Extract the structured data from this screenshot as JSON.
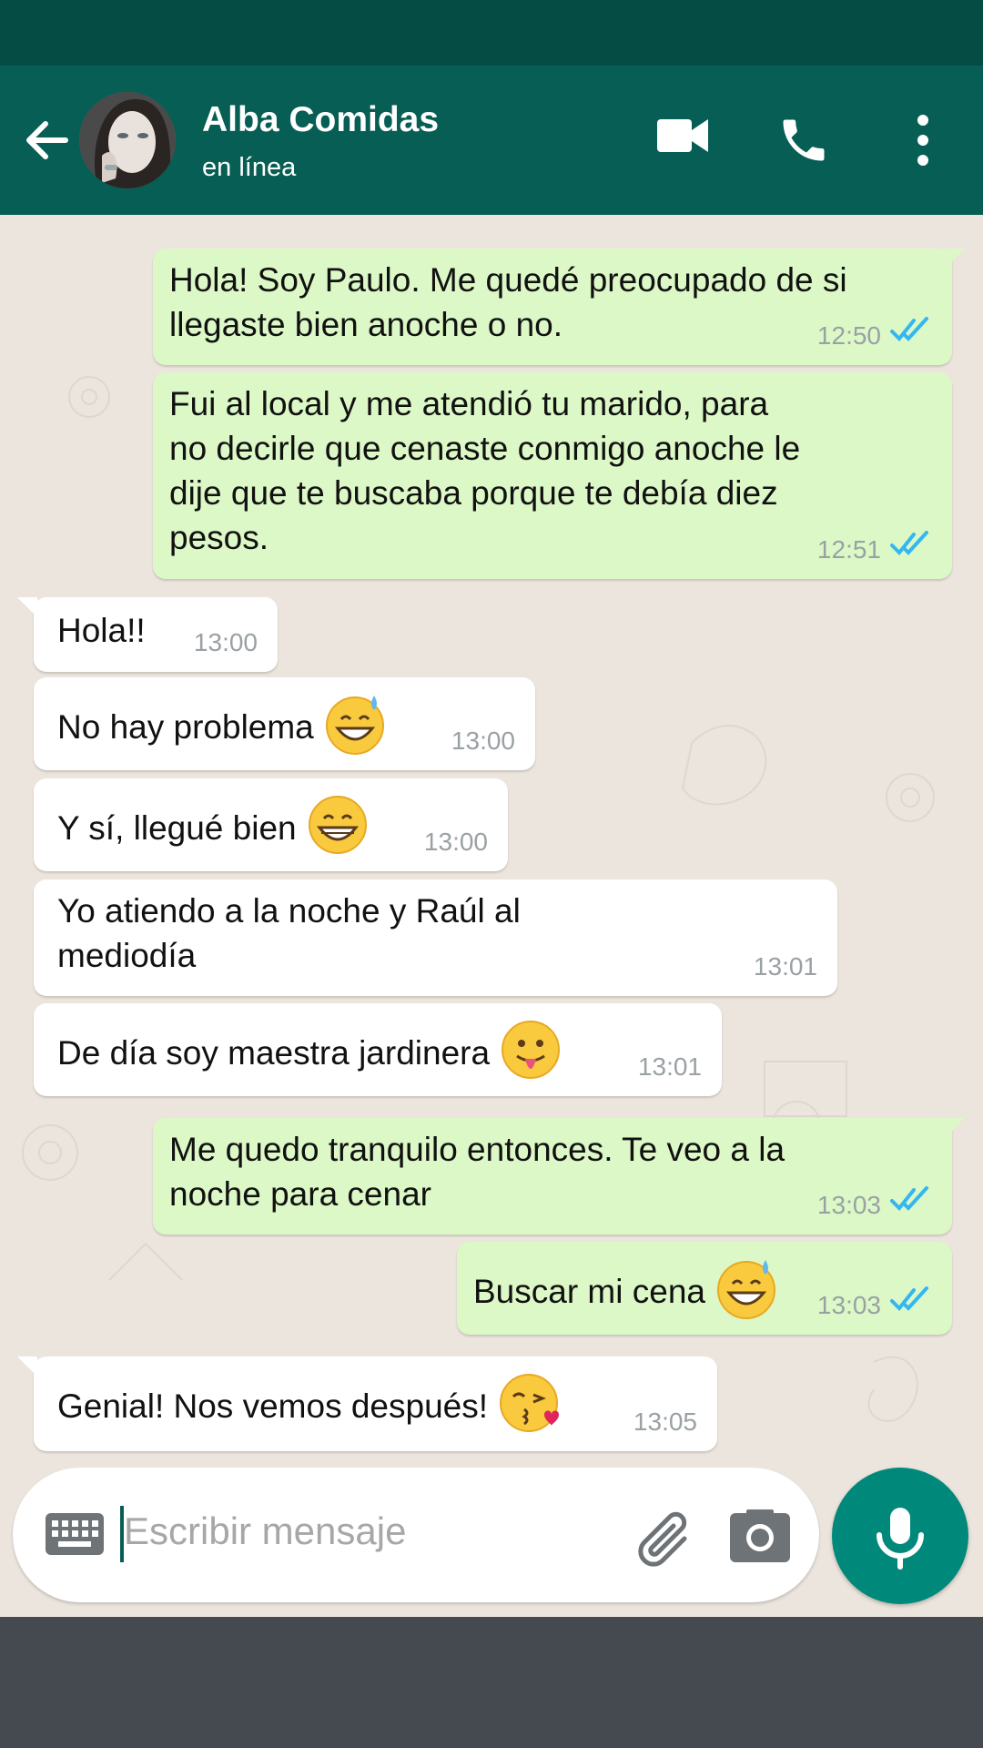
{
  "header": {
    "contact_name": "Alba Comidas",
    "status": "en línea",
    "icons": [
      "back-arrow-icon",
      "avatar",
      "video-call-icon",
      "phone-icon",
      "more-vert-icon"
    ]
  },
  "colors": {
    "header": "#075e54",
    "status_bar": "#054d44",
    "outgoing_bubble": "#dcf8c6",
    "incoming_bubble": "#ffffff",
    "read_ticks": "#34b7f1",
    "mic_button": "#00897b",
    "chat_background": "#ece5dd"
  },
  "messages": [
    {
      "direction": "out",
      "lines": [
        "Hola! Soy Paulo. Me quedé preocupado de si",
        "llegaste bien anoche o no."
      ],
      "time": "12:50",
      "status": "read"
    },
    {
      "direction": "out",
      "lines": [
        "Fui al local y me atendió tu marido, para",
        "no decirle que cenaste conmigo anoche le",
        "dije que te buscaba porque te debía diez",
        "pesos."
      ],
      "time": "12:51",
      "status": "read"
    },
    {
      "direction": "in",
      "lines": [
        "Hola!!"
      ],
      "time": "13:00"
    },
    {
      "direction": "in",
      "lines": [
        "No hay problema"
      ],
      "emoji": "sweat-smile",
      "time": "13:00"
    },
    {
      "direction": "in",
      "lines": [
        "Y sí, llegué bien"
      ],
      "emoji": "grin",
      "time": "13:00"
    },
    {
      "direction": "in",
      "lines": [
        "Yo atiendo a la noche y Raúl al",
        "mediodía"
      ],
      "time": "13:01"
    },
    {
      "direction": "in",
      "lines": [
        "De día soy maestra jardinera"
      ],
      "emoji": "tongue",
      "time": "13:01"
    },
    {
      "direction": "out",
      "lines": [
        "Me quedo tranquilo entonces. Te veo a la",
        "noche para cenar"
      ],
      "time": "13:03",
      "status": "read"
    },
    {
      "direction": "out",
      "lines": [
        "Buscar mi cena"
      ],
      "emoji": "sweat-smile",
      "time": "13:03",
      "status": "read"
    },
    {
      "direction": "in",
      "lines": [
        "Genial! Nos vemos después!"
      ],
      "emoji": "kiss",
      "time": "13:05"
    }
  ],
  "composer": {
    "placeholder": "Escribir mensaje",
    "icons": [
      "keyboard-icon",
      "attach-icon",
      "camera-icon",
      "mic-icon"
    ]
  }
}
